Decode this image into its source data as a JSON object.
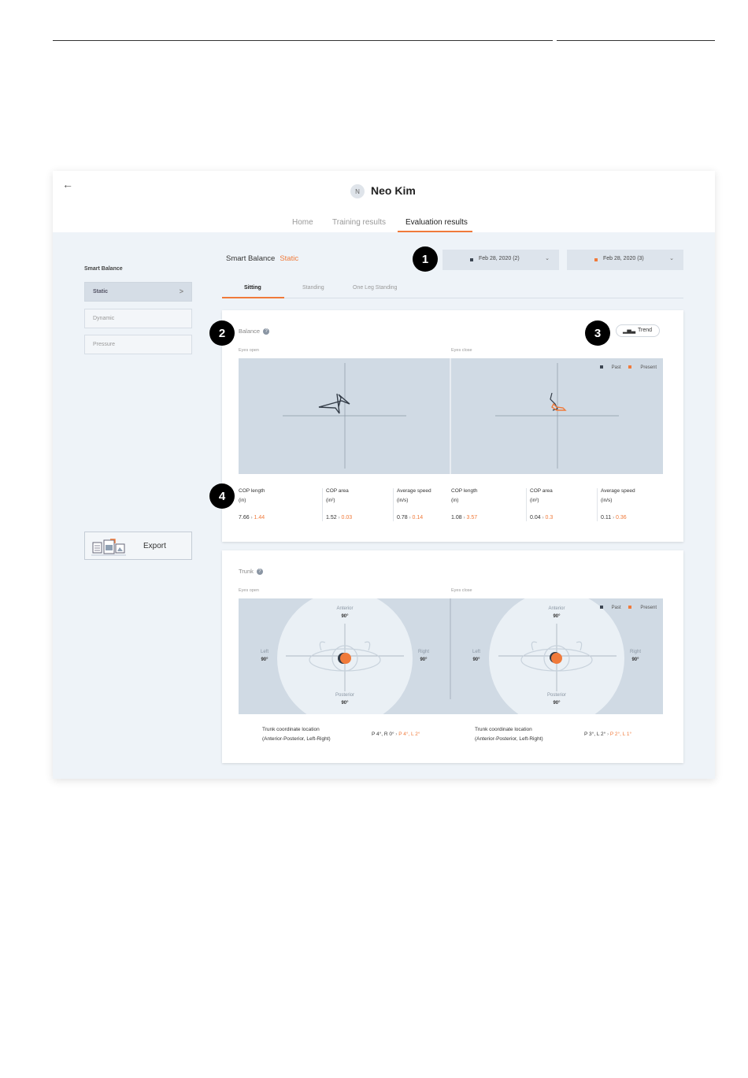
{
  "header": {
    "rule_left": "",
    "rule_right": ""
  },
  "app": {
    "back_icon": "arrow-left-icon",
    "user": {
      "initial": "N",
      "name": "Neo Kim"
    },
    "nav_tabs": [
      {
        "label": "Home"
      },
      {
        "label": "Training results"
      },
      {
        "label": "Evaluation results",
        "active": true
      }
    ],
    "accent_color": "#f07a3a"
  },
  "sidebar": {
    "title": "Smart Balance",
    "items": [
      {
        "label": "Static",
        "active": true
      },
      {
        "label": "Dynamic"
      },
      {
        "label": "Pressure"
      }
    ],
    "export_label": "Export"
  },
  "main": {
    "heading": "Smart Balance",
    "heading_accent": "Static",
    "date_selects": [
      {
        "label": "Feb 28, 2020 (2)",
        "color": "#3c4652"
      },
      {
        "label": "Feb 28, 2020 (3)",
        "color": "#f07a3a"
      }
    ],
    "sub_tabs": [
      {
        "label": "Sitting",
        "active": true
      },
      {
        "label": "Standing"
      },
      {
        "label": "One Leg Standing"
      }
    ]
  },
  "balance": {
    "title": "Balance",
    "trend_label": "Trend",
    "eyes_open_label": "Eyes open",
    "eyes_close_label": "Eyes close",
    "legend": {
      "past": "Past",
      "present": "Present"
    },
    "metrics": [
      {
        "label": "COP length",
        "unit": "(in)",
        "past": "7.66",
        "present": "1.44"
      },
      {
        "label": "COP area",
        "unit": "(in²)",
        "past": "1.52",
        "present": "0.03"
      },
      {
        "label": "Average speed",
        "unit": "(in/s)",
        "past": "0.78",
        "present": "0.14"
      },
      {
        "label": "COP length",
        "unit": "(in)",
        "past": "1.08",
        "present": "3.57"
      },
      {
        "label": "COP area",
        "unit": "(in²)",
        "past": "0.04",
        "present": "0.3"
      },
      {
        "label": "Average speed",
        "unit": "(in/s)",
        "past": "0.11",
        "present": "0.36"
      }
    ]
  },
  "trunk": {
    "title": "Trunk",
    "eyes_open_label": "Eyes open",
    "eyes_close_label": "Eyes close",
    "legend": {
      "past": "Past",
      "present": "Present"
    },
    "directions": {
      "anterior": "Anterior",
      "posterior": "Posterior",
      "left": "Left",
      "right": "Right",
      "angle": "90°"
    },
    "location_label_1": "Trunk coordinate location",
    "location_label_2": "(Anterior-Posterior, Left-Right)",
    "results": [
      {
        "past": "P 4°, R 0°",
        "present": "P 4°, L 2°"
      },
      {
        "past": "P 3°, L 2°",
        "present": "P 2°, L 1°"
      }
    ]
  },
  "callouts": [
    "1",
    "2",
    "3",
    "4"
  ]
}
